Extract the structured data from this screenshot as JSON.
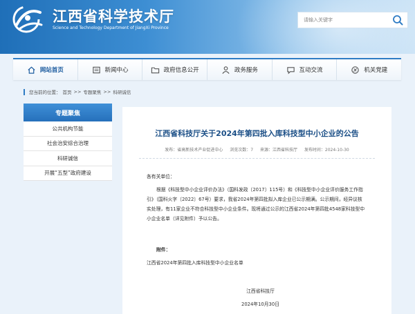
{
  "header": {
    "title": "江西省科学技术厅",
    "subtitle": "Science and Technology Department of JiangXi Province",
    "search_placeholder": "请输入关键字"
  },
  "nav": [
    {
      "label": "网站首页",
      "icon": "home-icon",
      "active": true
    },
    {
      "label": "新闻中心",
      "icon": "news-icon",
      "active": false
    },
    {
      "label": "政府信息公开",
      "icon": "folder-icon",
      "active": false
    },
    {
      "label": "政务服务",
      "icon": "user-service-icon",
      "active": false
    },
    {
      "label": "互动交流",
      "icon": "chat-icon",
      "active": false
    },
    {
      "label": "机关党建",
      "icon": "party-icon",
      "active": false
    }
  ],
  "breadcrumb": {
    "prefix": "您当前的位置：",
    "items": [
      "首页",
      "专题聚焦",
      "科研诚信"
    ],
    "separator": ">>"
  },
  "sidebar": {
    "title": "专题聚焦",
    "items": [
      "公共机构节能",
      "社会治安综合治理",
      "科研诚信",
      "开展“五型”政府建设"
    ]
  },
  "article": {
    "title": "江西省科技厅关于2024年第四批入库科技型中小企业的公告",
    "meta": {
      "publisher": "发布：省高新技术产业促进中心",
      "views": "浏览次数：7",
      "source": "来源：江西省科技厅",
      "date": "发布时间：2024-10-30"
    },
    "salutation": "各有关单位：",
    "paragraph_lines": [
      "根据《科技型中小企业评价办法》（国科发政〔2017〕115号）和《科技型中小企业评价服务工作指",
      "引》（国科火字〔2022〕67号）要求，我省2024年第四批拟入库企业已公示期满。公示期间，经异议核",
      "实处理，有11家企业不符合科技型中小企业条件。现将通过公示的江西省2024年第四批4548家科技型中",
      "小企业名单（详见附件）予以公告。"
    ],
    "attachment_label": "附件：",
    "attachment_item": "江西省2024年第四批入库科技型中小企业名单",
    "signature_org": "江西省科技厅",
    "signature_date": "2024年10月30日"
  },
  "colors": {
    "brand_blue": "#2d7bc4",
    "title_blue": "#1a4e86",
    "background": "#eaf2fa"
  }
}
